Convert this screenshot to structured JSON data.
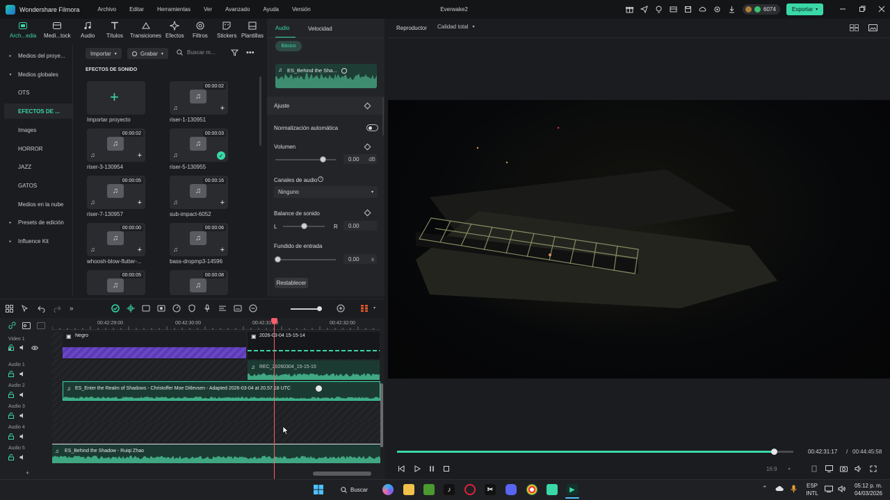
{
  "app": {
    "name": "Wondershare Filmora",
    "project": "Everwake2"
  },
  "menu": [
    "Archivo",
    "Editar",
    "Herramientas",
    "Ver",
    "Avanzado",
    "Ayuda",
    "Versión"
  ],
  "titlebar": {
    "credits": "6074",
    "export_label": "Exportar"
  },
  "media_tabs": [
    "Arch...edia",
    "Medi...tock",
    "Audio",
    "Títulos",
    "Transiciones",
    "Efectos",
    "Filtros",
    "Stickers",
    "Plantillas"
  ],
  "sidebar": {
    "items": [
      "Medios del proye...",
      "Medios globales",
      "OTS",
      "EFECTOS DE ...",
      "Images",
      "HORROR",
      "JAZZ",
      "GATOS",
      "Medios en la nube",
      "Presets de edición",
      "Influence Kit"
    ]
  },
  "library": {
    "import_label": "Importar",
    "record_label": "Grabar",
    "search_placeholder": "Buscar m...",
    "section_title": "EFECTOS DE SONIDO",
    "import_project_label": "Importar proyecto",
    "items": [
      {
        "name": "riser-1-130951",
        "duration": "00:00:02"
      },
      {
        "name": "riser-3-130954",
        "duration": "00:00:02"
      },
      {
        "name": "riser-5-130955",
        "duration": "00:00:03"
      },
      {
        "name": "riser-7-130957",
        "duration": "00:00:05"
      },
      {
        "name": "sub-impact-6052",
        "duration": "00:00:16"
      },
      {
        "name": "whoosh-blow-flutter-...",
        "duration": "00:00:00"
      },
      {
        "name": "bass-dropmp3-14596",
        "duration": "00:00:06"
      },
      {
        "name": "",
        "duration": "00:00:05"
      },
      {
        "name": "",
        "duration": "00:00:08"
      }
    ]
  },
  "properties": {
    "tabs": [
      "Audio",
      "Velocidad"
    ],
    "basic_label": "Básico",
    "clip_name": "ES_Behind the Sha...",
    "adjust_label": "Ajuste",
    "auto_normalization_label": "Normalización automática",
    "volume_label": "Volumen",
    "volume_value": "0.00",
    "volume_unit": "dB",
    "volume_level": 0.78,
    "channels_label": "Canales de audio",
    "channels_value": "Ninguno",
    "balance_label": "Balance de sonido",
    "balance_left": "L",
    "balance_right": "R",
    "balance_value": "0.00",
    "balance_level": 0.5,
    "fadein_label": "Fundido de entrada",
    "fadein_value": "0.00",
    "fadein_unit": "s",
    "fadein_level": 0.0,
    "reset_label": "Restablecer"
  },
  "player": {
    "label": "Reproductor",
    "quality": "Calidad total",
    "current_time": "00:42:31:17",
    "separator": "/",
    "total_time": "00:44:45:58",
    "progress": 0.95,
    "aspect": "16:9"
  },
  "timeline": {
    "ruler": [
      "00:42:29:00",
      "00:42:30:00",
      "00:42:31:00",
      "00:42:32:00"
    ],
    "tracks": [
      "Video 1",
      "Audio 1",
      "Audio 2",
      "Audio 3",
      "Audio 4",
      "Audio 5"
    ],
    "clips": {
      "negro": "Negro",
      "video": "2026-03-04 15-15-14",
      "audio1": "REC_20260304_15-15-15",
      "audio2": "ES_Enter the Realm of Shadows - Christoffer Moe Ditlevsen - Adapted 2026-03-04 at 20.57.18 UTC",
      "audio5": "ES_Behind the Shadow - Ruiqi Zhao"
    }
  },
  "taskbar": {
    "search_label": "Buscar",
    "lang_top": "ESP",
    "lang_bottom": "INTL",
    "time": "05:12 p. m.",
    "date": "04/03/2026"
  },
  "colors": {
    "accent": "#3ad8a6",
    "playhead": "#ff5c6a",
    "negro_clip": "#6a47c9"
  }
}
